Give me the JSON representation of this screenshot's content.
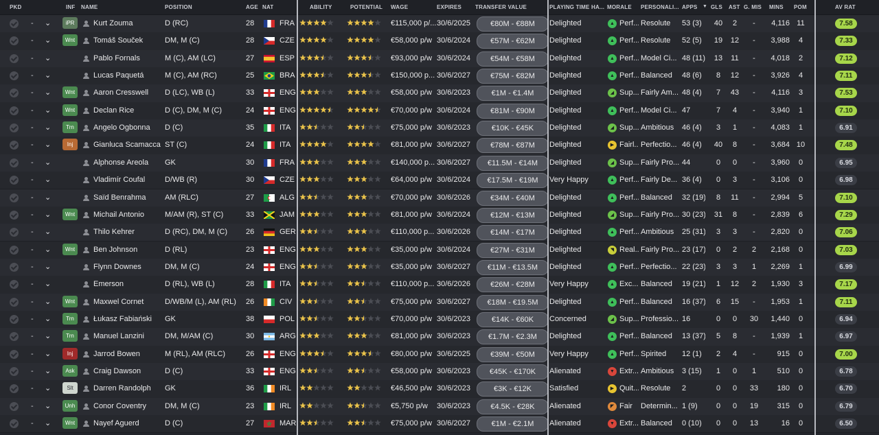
{
  "colors": {
    "good_rating": "#a7d64a",
    "star": "#e9c24a",
    "star_empty": "#4b4d54"
  },
  "headers": {
    "pkd": "PKD",
    "inf": "INF",
    "name": "NAME",
    "position": "POSITION",
    "age": "AGE",
    "nat": "NAT",
    "ability": "ABILITY",
    "potential": "POTENTIAL",
    "wage": "WAGE",
    "expires": "EXPIRES",
    "transfer_value": "TRANSFER VALUE",
    "playing_time": "PLAYING TIME HA...",
    "morale": "MORALE",
    "personality": "PERSONALI...",
    "apps": "APPS",
    "gls": "GLS",
    "ast": "AST",
    "gmis": "G. MIS",
    "mins": "MINS",
    "pom": "POM",
    "av_rat": "AV RAT"
  },
  "players": [
    {
      "inf": "iPR",
      "inf_color": "ipr",
      "name": "Kurt Zouma",
      "position": "D (RC)",
      "age": "28",
      "nat": "FRA",
      "flag": "fra",
      "ability": 4,
      "potential": 4,
      "wage": "€115,000 p/...",
      "expires": "30/6/2025",
      "tv": "€80M - €88M",
      "pt": "Delighted",
      "morale": "Perf...",
      "morale_icon": "up",
      "pers": "Resolute",
      "apps": "53 (3)",
      "gls": "40",
      "ast": "2",
      "gmis": "-",
      "mins": "4,116",
      "pom": "11",
      "rat": "7.58",
      "rat_good": true
    },
    {
      "inf": "Wnt",
      "inf_color": "green",
      "name": "Tomáš Souček",
      "position": "DM, M (C)",
      "age": "28",
      "nat": "CZE",
      "flag": "cze",
      "ability": 4,
      "potential": 4,
      "wage": "€58,000 p/w",
      "expires": "30/6/2024",
      "tv": "€57M - €62M",
      "pt": "Delighted",
      "morale": "Perf...",
      "morale_icon": "up",
      "pers": "Resolute",
      "apps": "52 (5)",
      "gls": "19",
      "ast": "12",
      "gmis": "-",
      "mins": "3,988",
      "pom": "4",
      "rat": "7.33",
      "rat_good": true
    },
    {
      "inf": "",
      "inf_color": "",
      "name": "Pablo Fornals",
      "position": "M (C), AM (LC)",
      "age": "27",
      "nat": "ESP",
      "flag": "esp",
      "ability": 3.5,
      "potential": 3.5,
      "wage": "€93,000 p/w",
      "expires": "30/6/2024",
      "tv": "€54M - €58M",
      "pt": "Delighted",
      "morale": "Perf...",
      "morale_icon": "up",
      "pers": "Model Ci...",
      "apps": "48 (11)",
      "gls": "13",
      "ast": "11",
      "gmis": "-",
      "mins": "4,018",
      "pom": "2",
      "rat": "7.12",
      "rat_good": true
    },
    {
      "inf": "",
      "inf_color": "",
      "name": "Lucas Paquetá",
      "position": "M (C), AM (RC)",
      "age": "25",
      "nat": "BRA",
      "flag": "bra",
      "ability": 3.5,
      "potential": 3.5,
      "wage": "€150,000 p...",
      "expires": "30/6/2027",
      "tv": "€75M - €82M",
      "pt": "Delighted",
      "morale": "Perf...",
      "morale_icon": "up",
      "pers": "Balanced",
      "apps": "48 (6)",
      "gls": "8",
      "ast": "12",
      "gmis": "-",
      "mins": "3,926",
      "pom": "4",
      "rat": "7.11",
      "rat_good": true
    },
    {
      "inf": "Wnt",
      "inf_color": "green",
      "name": "Aaron Cresswell",
      "position": "D (LC), WB (L)",
      "age": "33",
      "nat": "ENG",
      "flag": "eng",
      "ability": 3,
      "potential": 3,
      "wage": "€58,000 p/w",
      "expires": "30/6/2023",
      "tv": "€1M - €1.4M",
      "pt": "Delighted",
      "morale": "Sup...",
      "morale_icon": "sup",
      "pers": "Fairly Am...",
      "apps": "48 (4)",
      "gls": "7",
      "ast": "43",
      "gmis": "-",
      "mins": "4,116",
      "pom": "3",
      "rat": "7.53",
      "rat_good": true
    },
    {
      "inf": "Wnt",
      "inf_color": "green",
      "name": "Declan Rice",
      "position": "D (C), DM, M (C)",
      "age": "24",
      "nat": "ENG",
      "flag": "eng",
      "ability": 4.5,
      "potential": 4.5,
      "wage": "€70,000 p/w",
      "expires": "30/6/2024",
      "tv": "€81M - €90M",
      "pt": "Delighted",
      "morale": "Perf...",
      "morale_icon": "up",
      "pers": "Model Ci...",
      "apps": "47",
      "gls": "7",
      "ast": "4",
      "gmis": "-",
      "mins": "3,940",
      "pom": "1",
      "rat": "7.10",
      "rat_good": true
    },
    {
      "inf": "Trn",
      "inf_color": "green",
      "name": "Angelo Ogbonna",
      "position": "D (C)",
      "age": "35",
      "nat": "ITA",
      "flag": "ita",
      "ability": 2.5,
      "potential": 2.5,
      "wage": "€75,000 p/w",
      "expires": "30/6/2023",
      "tv": "€10K - €45K",
      "pt": "Delighted",
      "morale": "Sup...",
      "morale_icon": "sup",
      "pers": "Ambitious",
      "apps": "46 (4)",
      "gls": "3",
      "ast": "1",
      "gmis": "-",
      "mins": "4,083",
      "pom": "1",
      "rat": "6.91",
      "rat_good": false
    },
    {
      "inf": "Inj",
      "inf_color": "orange",
      "name": "Gianluca Scamacca",
      "position": "ST (C)",
      "age": "24",
      "nat": "ITA",
      "flag": "ita",
      "ability": 4,
      "potential": 4,
      "wage": "€81,000 p/w",
      "expires": "30/6/2027",
      "tv": "€78M - €87M",
      "pt": "Delighted",
      "morale": "Fairl...",
      "morale_icon": "fair",
      "pers": "Perfectio...",
      "apps": "46 (4)",
      "gls": "40",
      "ast": "8",
      "gmis": "-",
      "mins": "3,684",
      "pom": "10",
      "rat": "7.48",
      "rat_good": true
    },
    {
      "inf": "",
      "inf_color": "",
      "name": "Alphonse Areola",
      "position": "GK",
      "age": "30",
      "nat": "FRA",
      "flag": "fra",
      "ability": 3,
      "potential": 3,
      "wage": "€140,000 p...",
      "expires": "30/6/2027",
      "tv": "€11.5M - €14M",
      "pt": "Delighted",
      "morale": "Sup...",
      "morale_icon": "sup",
      "pers": "Fairly Pro...",
      "apps": "44",
      "gls": "0",
      "ast": "0",
      "gmis": "-",
      "mins": "3,960",
      "pom": "0",
      "rat": "6.95",
      "rat_good": false
    },
    {
      "inf": "",
      "inf_color": "",
      "name": "Vladimír Coufal",
      "position": "D/WB (R)",
      "age": "30",
      "nat": "CZE",
      "flag": "cze",
      "ability": 3,
      "potential": 3,
      "wage": "€64,000 p/w",
      "expires": "30/6/2024",
      "tv": "€17.5M - €19M",
      "pt": "Very Happy",
      "morale": "Perf...",
      "morale_icon": "up",
      "pers": "Fairly De...",
      "apps": "36 (4)",
      "gls": "0",
      "ast": "3",
      "gmis": "-",
      "mins": "3,106",
      "pom": "0",
      "rat": "6.98",
      "rat_good": false
    },
    {
      "inf": "",
      "inf_color": "",
      "name": "Saïd Benrahma",
      "position": "AM (RLC)",
      "age": "27",
      "nat": "ALG",
      "flag": "alg",
      "ability": 2.5,
      "potential": 3,
      "wage": "€70,000 p/w",
      "expires": "30/6/2026",
      "tv": "€34M - €40M",
      "pt": "Delighted",
      "morale": "Perf...",
      "morale_icon": "up",
      "pers": "Balanced",
      "apps": "32 (19)",
      "gls": "8",
      "ast": "11",
      "gmis": "-",
      "mins": "2,994",
      "pom": "5",
      "rat": "7.10",
      "rat_good": true
    },
    {
      "inf": "Wnt",
      "inf_color": "green",
      "name": "Michail Antonio",
      "position": "M/AM (R), ST (C)",
      "age": "33",
      "nat": "JAM",
      "flag": "jam",
      "ability": 3,
      "potential": 3,
      "wage": "€81,000 p/w",
      "expires": "30/6/2024",
      "tv": "€12M - €13M",
      "pt": "Delighted",
      "morale": "Sup...",
      "morale_icon": "sup",
      "pers": "Fairly Pro...",
      "apps": "30 (23)",
      "gls": "31",
      "ast": "8",
      "gmis": "-",
      "mins": "2,839",
      "pom": "6",
      "rat": "7.29",
      "rat_good": true
    },
    {
      "inf": "",
      "inf_color": "",
      "name": "Thilo Kehrer",
      "position": "D (RC), DM, M (C)",
      "age": "26",
      "nat": "GER",
      "flag": "ger",
      "ability": 2.5,
      "potential": 3,
      "wage": "€110,000 p...",
      "expires": "30/6/2026",
      "tv": "€14M - €17M",
      "pt": "Delighted",
      "morale": "Perf...",
      "morale_icon": "up",
      "pers": "Ambitious",
      "apps": "25 (31)",
      "gls": "3",
      "ast": "3",
      "gmis": "-",
      "mins": "2,820",
      "pom": "0",
      "rat": "7.06",
      "rat_good": true
    },
    {
      "inf": "Wnt",
      "inf_color": "green",
      "name": "Ben Johnson",
      "position": "D (RL)",
      "age": "23",
      "nat": "ENG",
      "flag": "eng",
      "ability": 3,
      "potential": 3,
      "wage": "€35,000 p/w",
      "expires": "30/6/2024",
      "tv": "€27M - €31M",
      "pt": "Delighted",
      "morale": "Real...",
      "morale_icon": "real",
      "pers": "Fairly Pro...",
      "apps": "23 (17)",
      "gls": "0",
      "ast": "2",
      "gmis": "2",
      "mins": "2,168",
      "pom": "0",
      "rat": "7.03",
      "rat_good": true
    },
    {
      "inf": "",
      "inf_color": "",
      "name": "Flynn Downes",
      "position": "DM, M (C)",
      "age": "24",
      "nat": "ENG",
      "flag": "eng",
      "ability": 2.5,
      "potential": 3,
      "wage": "€35,000 p/w",
      "expires": "30/6/2027",
      "tv": "€11M - €13.5M",
      "pt": "Delighted",
      "morale": "Perf...",
      "morale_icon": "up",
      "pers": "Perfectio...",
      "apps": "22 (23)",
      "gls": "3",
      "ast": "3",
      "gmis": "1",
      "mins": "2,269",
      "pom": "1",
      "rat": "6.99",
      "rat_good": false
    },
    {
      "inf": "",
      "inf_color": "",
      "name": "Emerson",
      "position": "D (RL), WB (L)",
      "age": "28",
      "nat": "ITA",
      "flag": "ita",
      "ability": 2.5,
      "potential": 2.5,
      "wage": "€110,000 p...",
      "expires": "30/6/2026",
      "tv": "€26M - €28M",
      "pt": "Very Happy",
      "morale": "Exc...",
      "morale_icon": "up",
      "pers": "Balanced",
      "apps": "19 (21)",
      "gls": "1",
      "ast": "12",
      "gmis": "2",
      "mins": "1,930",
      "pom": "3",
      "rat": "7.17",
      "rat_good": true
    },
    {
      "inf": "Wnt",
      "inf_color": "green",
      "name": "Maxwel Cornet",
      "position": "D/WB/M (L), AM (RL)",
      "age": "26",
      "nat": "CIV",
      "flag": "civ",
      "ability": 2.5,
      "potential": 2.5,
      "wage": "€75,000 p/w",
      "expires": "30/6/2027",
      "tv": "€18M - €19.5M",
      "pt": "Delighted",
      "morale": "Perf...",
      "morale_icon": "up",
      "pers": "Balanced",
      "apps": "16 (37)",
      "gls": "6",
      "ast": "15",
      "gmis": "-",
      "mins": "1,953",
      "pom": "1",
      "rat": "7.11",
      "rat_good": true
    },
    {
      "inf": "Trn",
      "inf_color": "green",
      "name": "Łukasz Fabiański",
      "position": "GK",
      "age": "38",
      "nat": "POL",
      "flag": "pol",
      "ability": 2.5,
      "potential": 2.5,
      "wage": "€70,000 p/w",
      "expires": "30/6/2023",
      "tv": "€14K - €60K",
      "pt": "Concerned",
      "morale": "Sup...",
      "morale_icon": "sup",
      "pers": "Professio...",
      "apps": "16",
      "gls": "0",
      "ast": "0",
      "gmis": "30",
      "mins": "1,440",
      "pom": "0",
      "rat": "6.94",
      "rat_good": false
    },
    {
      "inf": "Trn",
      "inf_color": "green",
      "name": "Manuel Lanzini",
      "position": "DM, M/AM (C)",
      "age": "30",
      "nat": "ARG",
      "flag": "arg",
      "ability": 3,
      "potential": 3,
      "wage": "€81,000 p/w",
      "expires": "30/6/2023",
      "tv": "€1.7M - €2.3M",
      "pt": "Delighted",
      "morale": "Perf...",
      "morale_icon": "up",
      "pers": "Balanced",
      "apps": "13 (37)",
      "gls": "5",
      "ast": "8",
      "gmis": "-",
      "mins": "1,939",
      "pom": "1",
      "rat": "6.97",
      "rat_good": false
    },
    {
      "inf": "Inj",
      "inf_color": "red",
      "name": "Jarrod Bowen",
      "position": "M (RL), AM (RLC)",
      "age": "26",
      "nat": "ENG",
      "flag": "eng",
      "ability": 3.5,
      "potential": 3.5,
      "wage": "€80,000 p/w",
      "expires": "30/6/2025",
      "tv": "€39M - €50M",
      "pt": "Very Happy",
      "morale": "Perf...",
      "morale_icon": "up",
      "pers": "Spirited",
      "apps": "12 (1)",
      "gls": "2",
      "ast": "4",
      "gmis": "-",
      "mins": "915",
      "pom": "0",
      "rat": "7.00",
      "rat_good": true
    },
    {
      "inf": "Ask",
      "inf_color": "green",
      "name": "Craig Dawson",
      "position": "D (C)",
      "age": "33",
      "nat": "ENG",
      "flag": "eng",
      "ability": 2.5,
      "potential": 2.5,
      "wage": "€58,000 p/w",
      "expires": "30/6/2023",
      "tv": "€45K - €170K",
      "pt": "Alienated",
      "morale": "Extr...",
      "morale_icon": "down",
      "pers": "Ambitious",
      "apps": "3 (15)",
      "gls": "1",
      "ast": "0",
      "gmis": "1",
      "mins": "510",
      "pom": "0",
      "rat": "6.78",
      "rat_good": false
    },
    {
      "inf": "Slt",
      "inf_color": "white",
      "name": "Darren Randolph",
      "position": "GK",
      "age": "36",
      "nat": "IRL",
      "flag": "irl",
      "ability": 2,
      "potential": 2,
      "wage": "€46,500 p/w",
      "expires": "30/6/2023",
      "tv": "€3K - €12K",
      "pt": "Satisfied",
      "morale": "Quit...",
      "morale_icon": "fair",
      "pers": "Resolute",
      "apps": "2",
      "gls": "0",
      "ast": "0",
      "gmis": "33",
      "mins": "180",
      "pom": "0",
      "rat": "6.70",
      "rat_good": false
    },
    {
      "inf": "Unh",
      "inf_color": "green",
      "name": "Conor Coventry",
      "position": "DM, M (C)",
      "age": "23",
      "nat": "IRL",
      "flag": "irl",
      "ability": 2,
      "potential": 2.5,
      "wage": "€5,750 p/w",
      "expires": "30/6/2023",
      "tv": "€4.5K - €28K",
      "pt": "Alienated",
      "morale": "Fair",
      "morale_icon": "poor",
      "pers": "Determin...",
      "apps": "1 (9)",
      "gls": "0",
      "ast": "0",
      "gmis": "19",
      "mins": "315",
      "pom": "0",
      "rat": "6.79",
      "rat_good": false
    },
    {
      "inf": "Wnt",
      "inf_color": "green",
      "name": "Nayef Aguerd",
      "position": "D (C)",
      "age": "27",
      "nat": "MAR",
      "flag": "mar",
      "ability": 2.5,
      "potential": 2.5,
      "wage": "€75,000 p/w",
      "expires": "30/6/2027",
      "tv": "€1M - €2.1M",
      "pt": "Alienated",
      "morale": "Extr...",
      "morale_icon": "down",
      "pers": "Balanced",
      "apps": "0 (10)",
      "gls": "0",
      "ast": "0",
      "gmis": "13",
      "mins": "16",
      "pom": "0",
      "rat": "6.50",
      "rat_good": false
    }
  ]
}
